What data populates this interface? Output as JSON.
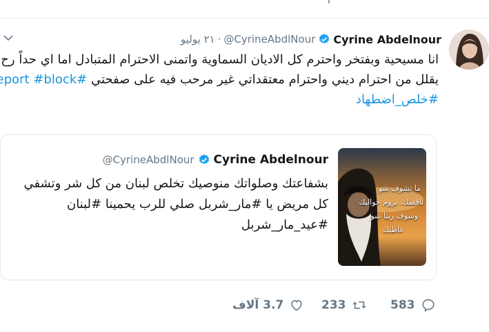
{
  "top_strip": {
    "faded_left": "ٓٓٓ",
    "faded_mid": "ٓ اٴ",
    "faded_right": "ٓ"
  },
  "tweet": {
    "author_name": "Cyrine Abdelnour",
    "handle": "@CyrineAbdlNour",
    "separator": "·",
    "date": "٢١ يوليو",
    "lines": [
      "انا مسيحية وبفتخر واحترم كل الاديان السماوية واتمنى الاحترام المتبادل اما اي حداً رح",
      "يقلل من احترام ديني واحترام معتقداتي غير مرحب فيه على صفحتي"
    ],
    "line2_hashtags": [
      "#report",
      "#block"
    ],
    "line3_hashtag": "#خلص_اضطهاد"
  },
  "quote": {
    "author_name": "Cyrine Abdelnour",
    "handle": "@CyrineAbdlNour",
    "lines": [
      "بشفاعتك وصلواتك منوصيك تخلص لبنان من كل شر  وتشفي",
      "كل مريض يا #مار_شربل صلي للرب يحمينا #لبنان",
      "#عيد_مار_شربل"
    ],
    "image_text": [
      "ما تشوف شو",
      "ناقصك، بروم حواليك",
      "وشوف ربنا شو",
      "عاطيك"
    ]
  },
  "actions": {
    "replies": "583",
    "retweets": "233",
    "likes": "3.7 آلاف"
  },
  "colors": {
    "link": "#1b95e0",
    "muted": "#657786",
    "verified": "#1da1f2"
  }
}
